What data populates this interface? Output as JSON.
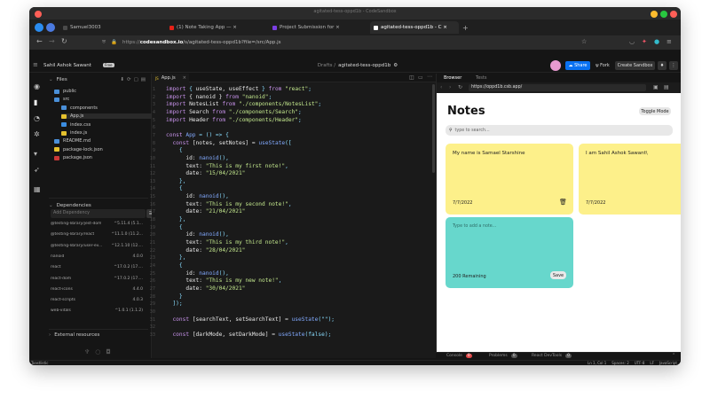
{
  "browser": {
    "window_title": "agitated-tess-oppd1b - CodeSandbox",
    "tabs": [
      {
        "label": "Samuel3003",
        "color": "#4a4a4a"
      },
      {
        "label": "(1) Note Taking App — ×",
        "color": "#e62117"
      },
      {
        "label": "Project Submission for  ×",
        "color": "#7b3fe4"
      },
      {
        "label": "agitated-tess-oppd1b - C ×",
        "color": "#ffffff"
      }
    ],
    "new_tab": "+",
    "url_prefix": "https://",
    "url_host": "codesandbox.io",
    "url_path": "/s/agitated-tess-oppd1b?file=/src/App.js"
  },
  "csb_header": {
    "user": "Sahil Ashok Sawant",
    "plan_badge": "Free",
    "breadcrumb_folder": "Drafts /",
    "sandbox_name": "agitated-tess-oppd1b",
    "share": "Share",
    "fork": "Fork",
    "create_sandbox": "Create Sandbox"
  },
  "explorer": {
    "files_title": "Files",
    "files": [
      {
        "name": "public",
        "icon": "folder",
        "depth": 0,
        "color": "#4a8fd8"
      },
      {
        "name": "src",
        "icon": "folder",
        "depth": 0,
        "color": "#4a8fd8"
      },
      {
        "name": "components",
        "icon": "folder",
        "depth": 1,
        "color": "#4a8fd8"
      },
      {
        "name": "App.js",
        "icon": "js-file",
        "depth": 1,
        "color": "#e5c12e"
      },
      {
        "name": "index.css",
        "icon": "css-file",
        "depth": 1,
        "color": "#3b8de0"
      },
      {
        "name": "index.js",
        "icon": "js-file",
        "depth": 1,
        "color": "#e5c12e"
      },
      {
        "name": "README.md",
        "icon": "info-file",
        "depth": 0,
        "color": "#4a8fd8"
      },
      {
        "name": "package-lock.json",
        "icon": "json-file",
        "depth": 0,
        "color": "#e5c12e"
      },
      {
        "name": "package.json",
        "icon": "npm-file",
        "depth": 0,
        "color": "#cb3837"
      }
    ],
    "deps_title": "Dependencies",
    "add_dep_placeholder": "Add Dependency",
    "dependencies": [
      {
        "name": "@testing-library/jest-dom",
        "version": "^5.11.4 (5.1..."
      },
      {
        "name": "@testing-library/react",
        "version": "^11.1.0 (11.2..."
      },
      {
        "name": "@testing-library/user-ev...",
        "version": "^12.1.10 (12...."
      },
      {
        "name": "nanoid",
        "version": "4.0.0"
      },
      {
        "name": "react",
        "version": "^17.0.2 (17...."
      },
      {
        "name": "react-dom",
        "version": "^17.0.2 (17...."
      },
      {
        "name": "react-icons",
        "version": "4.4.0"
      },
      {
        "name": "react-scripts",
        "version": "4.0.3"
      },
      {
        "name": "web-vitals",
        "version": "^1.0.1 (1.1.2)"
      }
    ],
    "external_title": "External resources"
  },
  "editor": {
    "tab": "App.js",
    "lines": [
      [
        [
          "kw",
          "import "
        ],
        [
          "pu",
          "{ "
        ],
        [
          "pr",
          "useState, useEffect "
        ],
        [
          "pu",
          "} "
        ],
        [
          "kw",
          "from "
        ],
        [
          "st",
          "\"react\""
        ],
        [
          "pu",
          ";"
        ]
      ],
      [
        [
          "kw",
          "import "
        ],
        [
          "pr",
          "{ nanoid } "
        ],
        [
          "kw",
          "from "
        ],
        [
          "st",
          "\"nanoid\""
        ],
        [
          "pu",
          ";"
        ]
      ],
      [
        [
          "kw",
          "import "
        ],
        [
          "pr",
          "NotesList "
        ],
        [
          "kw",
          "from "
        ],
        [
          "st",
          "\"./components/NotesList\""
        ],
        [
          "pu",
          ";"
        ]
      ],
      [
        [
          "kw",
          "import "
        ],
        [
          "pr",
          "Search "
        ],
        [
          "kw",
          "from "
        ],
        [
          "st",
          "\"./components/Search\""
        ],
        [
          "pu",
          ";"
        ]
      ],
      [
        [
          "kw",
          "import "
        ],
        [
          "pr",
          "Header "
        ],
        [
          "kw",
          "from "
        ],
        [
          "st",
          "\"./components/Header\""
        ],
        [
          "pu",
          ";"
        ]
      ],
      [],
      [
        [
          "kw",
          "const "
        ],
        [
          "fn",
          "App "
        ],
        [
          "pu",
          "= () => {"
        ]
      ],
      [
        [
          "pr",
          "  "
        ],
        [
          "kw",
          "const "
        ],
        [
          "pr",
          "[notes, setNotes] = "
        ],
        [
          "fn",
          "useState"
        ],
        [
          "pu",
          "(["
        ]
      ],
      [
        [
          "pu",
          "    {"
        ]
      ],
      [
        [
          "pr",
          "      id: "
        ],
        [
          "fn",
          "nanoid"
        ],
        [
          "pu",
          "(),"
        ]
      ],
      [
        [
          "pr",
          "      text: "
        ],
        [
          "st",
          "\"This is my first note!\""
        ],
        [
          "pu",
          ","
        ]
      ],
      [
        [
          "pr",
          "      date: "
        ],
        [
          "st",
          "\"15/04/2021\""
        ]
      ],
      [
        [
          "pu",
          "    },"
        ]
      ],
      [
        [
          "pu",
          "    {"
        ]
      ],
      [
        [
          "pr",
          "      id: "
        ],
        [
          "fn",
          "nanoid"
        ],
        [
          "pu",
          "(),"
        ]
      ],
      [
        [
          "pr",
          "      text: "
        ],
        [
          "st",
          "\"This is my second note!\""
        ],
        [
          "pu",
          ","
        ]
      ],
      [
        [
          "pr",
          "      date: "
        ],
        [
          "st",
          "\"21/04/2021\""
        ]
      ],
      [
        [
          "pu",
          "    },"
        ]
      ],
      [
        [
          "pu",
          "    {"
        ]
      ],
      [
        [
          "pr",
          "      id: "
        ],
        [
          "fn",
          "nanoid"
        ],
        [
          "pu",
          "(),"
        ]
      ],
      [
        [
          "pr",
          "      text: "
        ],
        [
          "st",
          "\"This is my third note!\""
        ],
        [
          "pu",
          ","
        ]
      ],
      [
        [
          "pr",
          "      date: "
        ],
        [
          "st",
          "\"28/04/2021\""
        ]
      ],
      [
        [
          "pu",
          "    },"
        ]
      ],
      [
        [
          "pu",
          "    {"
        ]
      ],
      [
        [
          "pr",
          "      id: "
        ],
        [
          "fn",
          "nanoid"
        ],
        [
          "pu",
          "(),"
        ]
      ],
      [
        [
          "pr",
          "      text: "
        ],
        [
          "st",
          "\"This is my new note!\""
        ],
        [
          "pu",
          ","
        ]
      ],
      [
        [
          "pr",
          "      date: "
        ],
        [
          "st",
          "\"30/04/2021\""
        ]
      ],
      [
        [
          "pu",
          "    }"
        ]
      ],
      [
        [
          "pu",
          "  ]);"
        ]
      ],
      [],
      [
        [
          "pr",
          "  "
        ],
        [
          "kw",
          "const "
        ],
        [
          "pr",
          "[searchText, setSearchText] = "
        ],
        [
          "fn",
          "useState"
        ],
        [
          "pu",
          "(\"\");"
        ]
      ],
      [],
      [
        [
          "pr",
          "  "
        ],
        [
          "kw",
          "const "
        ],
        [
          "pr",
          "[darkMode, setDarkMode] = "
        ],
        [
          "fn",
          "useState"
        ],
        [
          "pu",
          "(false);"
        ]
      ]
    ]
  },
  "preview": {
    "tab_browser": "Browser",
    "tab_tests": "Tests",
    "url": "https://oppd1b.csb.app/",
    "title": "Notes",
    "toggle_mode": "Toggle Mode",
    "search_placeholder": "type to search...",
    "notes": [
      {
        "text": "My name is Samael Starshine",
        "date": "7/7/2022"
      },
      {
        "text": "I am Sahil Ashok Sawant\\",
        "date": "7/7/2022"
      }
    ],
    "new_note_placeholder": "Type to add a note...",
    "remaining": "200 Remaining",
    "save": "Save",
    "note_color": "#fdf08a",
    "new_note_color": "#67d7cc"
  },
  "bottom": {
    "console": "Console",
    "console_count": "0",
    "problems": "Problems",
    "problems_count": "0",
    "devtools": "React DevTools",
    "devtools_count": "0"
  },
  "statusbar": {
    "left": "Toastlistic",
    "position": "Ln 1, Col 1",
    "spaces": "Spaces: 2",
    "encoding": "UTF-8",
    "eol": "LF",
    "language": "JavaScript"
  }
}
